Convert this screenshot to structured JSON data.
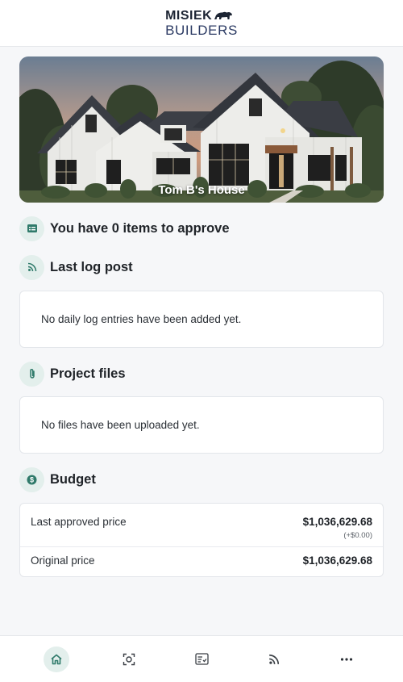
{
  "brand": {
    "line1": "MISIEK",
    "line2": "BUILDERS",
    "logo_icon": "bear-icon",
    "primary_color": "#1c2433",
    "accent_color": "#2b3a63"
  },
  "project": {
    "name": "Tom B's House",
    "image_icon": "house-photo"
  },
  "approvals": {
    "title": "You have 0 items to approve",
    "icon": "approval-list-icon"
  },
  "log": {
    "title": "Last log post",
    "icon": "rss-icon",
    "empty_text": "No daily log entries have been added yet."
  },
  "files": {
    "title": "Project files",
    "icon": "paperclip-icon",
    "empty_text": "No files have been uploaded yet."
  },
  "budget": {
    "title": "Budget",
    "icon": "dollar-icon",
    "rows": [
      {
        "label": "Last approved price",
        "value": "$1,036,629.68",
        "delta": "(+$0.00)"
      },
      {
        "label": "Original price",
        "value": "$1,036,629.68"
      }
    ]
  },
  "nav": {
    "items": [
      {
        "id": "home",
        "icon": "home-icon",
        "active": true
      },
      {
        "id": "scan",
        "icon": "scan-icon",
        "active": false
      },
      {
        "id": "approvals",
        "icon": "checklist-icon",
        "active": false
      },
      {
        "id": "feed",
        "icon": "rss-icon",
        "active": false
      },
      {
        "id": "more",
        "icon": "more-icon",
        "active": false
      }
    ]
  },
  "colors": {
    "accent_teal": "#2f7a6a",
    "icon_bg": "#e3efec",
    "page_bg": "#f6f7f9"
  }
}
